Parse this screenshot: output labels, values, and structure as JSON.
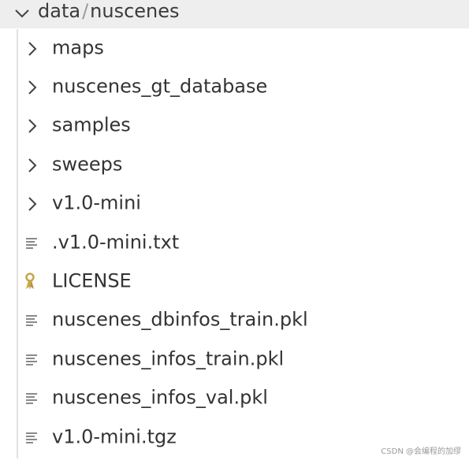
{
  "header": {
    "folder": "data",
    "separator": "/",
    "subfolder": "nuscenes"
  },
  "items": [
    {
      "label": "maps",
      "kind": "folder",
      "icon": "chevron-right-icon"
    },
    {
      "label": "nuscenes_gt_database",
      "kind": "folder",
      "icon": "chevron-right-icon"
    },
    {
      "label": "samples",
      "kind": "folder",
      "icon": "chevron-right-icon"
    },
    {
      "label": "sweeps",
      "kind": "folder",
      "icon": "chevron-right-icon"
    },
    {
      "label": "v1.0-mini",
      "kind": "folder",
      "icon": "chevron-right-icon"
    },
    {
      "label": ".v1.0-mini.txt",
      "kind": "file",
      "icon": "text-file-icon"
    },
    {
      "label": "LICENSE",
      "kind": "file",
      "icon": "license-key-icon"
    },
    {
      "label": "nuscenes_dbinfos_train.pkl",
      "kind": "file",
      "icon": "text-file-icon"
    },
    {
      "label": "nuscenes_infos_train.pkl",
      "kind": "file",
      "icon": "text-file-icon"
    },
    {
      "label": "nuscenes_infos_val.pkl",
      "kind": "file",
      "icon": "text-file-icon"
    },
    {
      "label": "v1.0-mini.tgz",
      "kind": "file",
      "icon": "text-file-icon"
    }
  ],
  "watermark": "CSDN @会编程的加缪",
  "colors": {
    "header_bg": "#eeeeee",
    "text": "#333333",
    "icon": "#424242",
    "file_icon": "#8a8a8a",
    "license_icon": "#c8a64a"
  }
}
